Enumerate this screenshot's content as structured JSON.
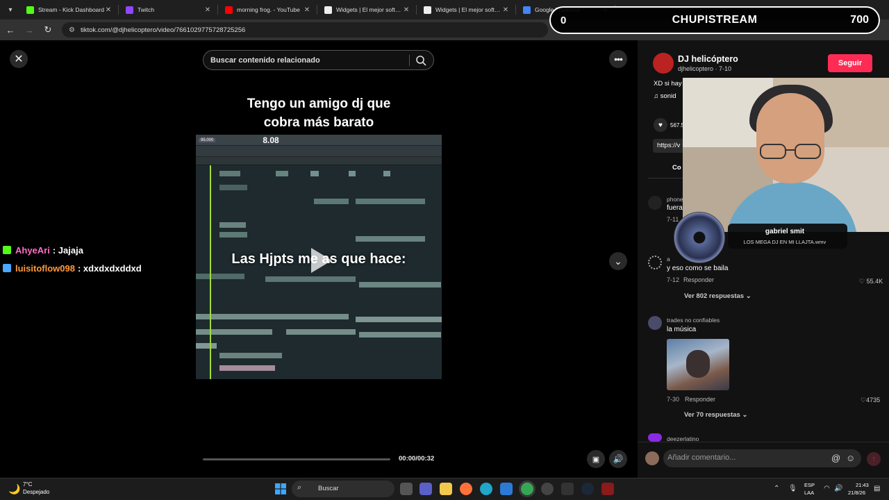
{
  "browser": {
    "tabs": [
      {
        "title": "Stream - Kick Dashboard",
        "color": "#53fc18"
      },
      {
        "title": "Twitch",
        "color": "#9146ff"
      },
      {
        "title": "morning frog. - YouTube",
        "color": "#ff0000"
      },
      {
        "title": "Widgets | El mejor softwar",
        "color": "#eeeeee"
      },
      {
        "title": "Widgets | El mejor softwar",
        "color": "#eeeeee"
      },
      {
        "title": "Google Traductor",
        "color": "#4285f4"
      }
    ],
    "url": "tiktok.com/@djhelicoptero/video/7661029775728725256"
  },
  "stream_overlay": {
    "left_count": "0",
    "title": "CHUPISTREAM",
    "right_count": "700"
  },
  "video": {
    "search_placeholder": "Buscar contenido relacionado",
    "caption_line1": "Tengo un amigo dj que",
    "caption_line2": "cobra más barato",
    "daw_time": "8.08",
    "caption_mid": "Las Hjpts me    as que hace:",
    "time": "00:00/00:32",
    "progress": 0.0
  },
  "chat": [
    {
      "user": "AhyeAri",
      "message": ": Jajaja",
      "user_color": "#ff6ec7",
      "badge_color": "#53fc18"
    },
    {
      "user": "luisitoflow098",
      "message": ": xdxdxdxddxd",
      "user_color": "#ff9a3c",
      "badge_color": "#4aa8ff"
    }
  ],
  "post": {
    "author_name": "DJ helicóptero",
    "author_sub": "djhelicoptero · 7-10",
    "follow_label": "Seguir",
    "description": "XD si hay",
    "sound": "♫  sonid",
    "likes": "567.5",
    "link": "https://v",
    "comments_tab": "Co"
  },
  "comments": [
    {
      "user": "phone",
      "text": "fuera",
      "date": "7-11"
    },
    {
      "user": "a",
      "text": "y eso como se baila",
      "date": "7-12",
      "reply": "Responder",
      "likes": "55.4K",
      "more": "Ver 802 respuestas"
    },
    {
      "user": "trades no confiables",
      "text": "la música",
      "date": "7-30",
      "reply": "Responder",
      "likes": "4735",
      "more": "Ver 70 respuestas"
    },
    {
      "user": "deezerlatino",
      "text": ""
    }
  ],
  "comment_bar": {
    "placeholder": "Añadir comentario..."
  },
  "now_playing": {
    "title": "gabriel smit",
    "subtitle": "LOS MEGA DJ EN MI LLAJTA.wmv"
  },
  "taskbar": {
    "temp": "7°C",
    "weather": "Despejado",
    "search": "Buscar",
    "lang1": "ESP",
    "lang2": "LAA",
    "time": "21:43",
    "date": "21/8/26"
  }
}
